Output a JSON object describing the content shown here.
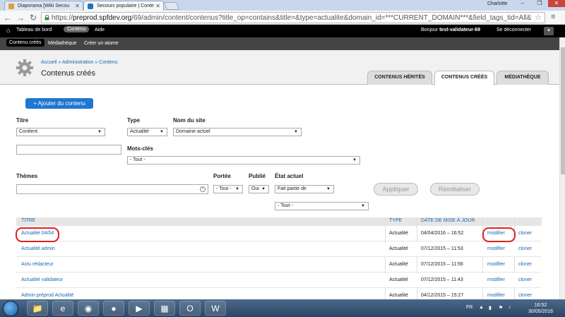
{
  "browser": {
    "tabs": [
      {
        "title": "Diaporama [Wiki Secou",
        "active": false,
        "color": "#d9a23a"
      },
      {
        "title": "Secours populaire | Conte",
        "active": true,
        "color": "#1e73be"
      }
    ],
    "profile": "Charlotte",
    "url_scheme": "https://",
    "url_host": "preprod.spfdev.org",
    "url_path": "/69/admin/content/contenus?title_op=contains&title=&type=actualite&domain_id=***CURRENT_DOMAIN***&field_tags_tid=All&field_t",
    "icons": {
      "back": "back-arrow-icon",
      "forward": "forward-arrow-icon",
      "reload": "reload-icon",
      "star": "star-icon",
      "menu": "hamburger-menu-icon"
    }
  },
  "toolbar": {
    "home_icon": "home-icon",
    "items": [
      "Tableau de bord",
      "Contenu",
      "Aide"
    ],
    "active_item": "Contenu",
    "greeting": "Bonjour",
    "username": "test-validateur-69",
    "logout": "Se déconnecter"
  },
  "shortcuts": {
    "items": [
      "Contenu créés",
      "Médiathèque",
      "Créer un atome"
    ],
    "active": "Contenu créés"
  },
  "page": {
    "breadcrumb": [
      "Accueil",
      "Administration",
      "Contenu"
    ],
    "breadcrumb_sep": "»",
    "title": "Contenus créés",
    "tabs": [
      "CONTENUS HÉRITÉS",
      "CONTENUS CRÉÉS",
      "MÉDIATHÈQUE"
    ],
    "active_tab": "CONTENUS CRÉÉS"
  },
  "add_button": "+ Ajouter du contenu",
  "filters": {
    "titre_label": "Titre",
    "titre_op": "Contient",
    "titre_value": "",
    "type_label": "Type",
    "type_value": "Actualité",
    "site_label": "Nom du site",
    "site_value": "Domaine actuel",
    "tags_label": "Mots-clés",
    "tags_value": "- Tout -",
    "themes_label": "Thèmes",
    "themes_value": "",
    "portee_label": "Portée",
    "portee_value": "- Tout -",
    "publie_label": "Publié",
    "publie_value": "Oui",
    "etat_label": "État actuel",
    "etat_op": "Fait partie de",
    "etat_value": "- Tout -",
    "apply": "Appliquer",
    "reset": "Réinitialiser"
  },
  "table": {
    "headers": [
      "TITRE",
      "TYPE",
      "DATE DE MISE À JOUR"
    ],
    "rows": [
      {
        "title": "Actualité 04/04",
        "type": "Actualité",
        "date": "04/04/2016 – 16:52",
        "edit": "modifier",
        "clone": "cloner"
      },
      {
        "title": "Actualité admin",
        "type": "Actualité",
        "date": "07/12/2015 – 11:53",
        "edit": "modifier",
        "clone": "cloner"
      },
      {
        "title": "Actu rédacteur",
        "type": "Actualité",
        "date": "07/12/2015 – 11:56",
        "edit": "modifier",
        "clone": "cloner"
      },
      {
        "title": "Actualité validateur",
        "type": "Actualité",
        "date": "07/12/2015 – 11:43",
        "edit": "modifier",
        "clone": "cloner"
      },
      {
        "title": "Admin préprod Actualité",
        "type": "Actualité",
        "date": "04/12/2015 – 15:27",
        "edit": "modifier",
        "clone": "cloner"
      }
    ]
  },
  "taskbar": {
    "apps": [
      "file-explorer-icon",
      "internet-explorer-icon",
      "chrome-icon",
      "firefox-icon",
      "media-player-icon",
      "project-icon",
      "outlook-icon",
      "word-icon"
    ],
    "lang": "FR",
    "time": "16:52",
    "date": "30/05/2016"
  },
  "colors": {
    "link": "#1a66b0",
    "accent_button": "#1f77d0",
    "highlight_circle": "#e0201d"
  }
}
